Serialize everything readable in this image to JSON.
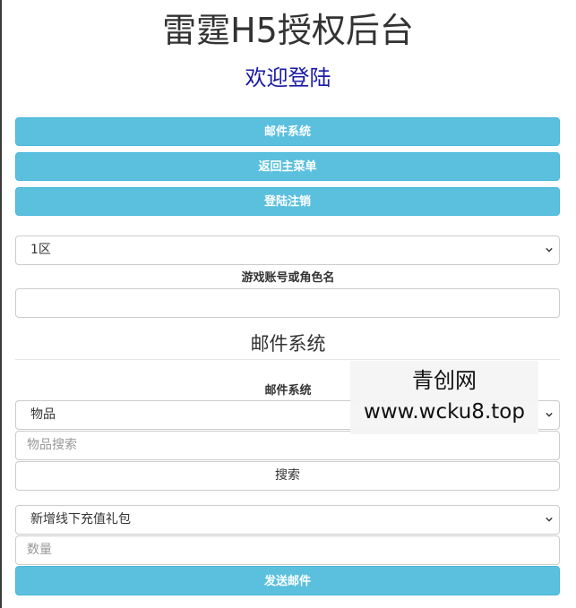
{
  "header": {
    "title": "雷霆H5授权后台",
    "subtitle": "欢迎登陆"
  },
  "nav": {
    "mail_system": "邮件系统",
    "back_to_menu": "返回主菜单",
    "logout": "登陆注销"
  },
  "account": {
    "server_select": "1区",
    "account_label": "游戏账号或角色名",
    "account_value": ""
  },
  "mail": {
    "section_title": "邮件系统",
    "label": "邮件系统",
    "type_select": "物品",
    "item_search_placeholder": "物品搜索",
    "search_button": "搜索",
    "item_select": "新增线下充值礼包",
    "quantity_placeholder": "数量",
    "send_button": "发送邮件"
  },
  "watermark": {
    "line1": "青创网",
    "line2": "www.wcku8.top"
  },
  "colors": {
    "info_button": "#5bc0de",
    "subtitle": "#1a1aa6"
  }
}
